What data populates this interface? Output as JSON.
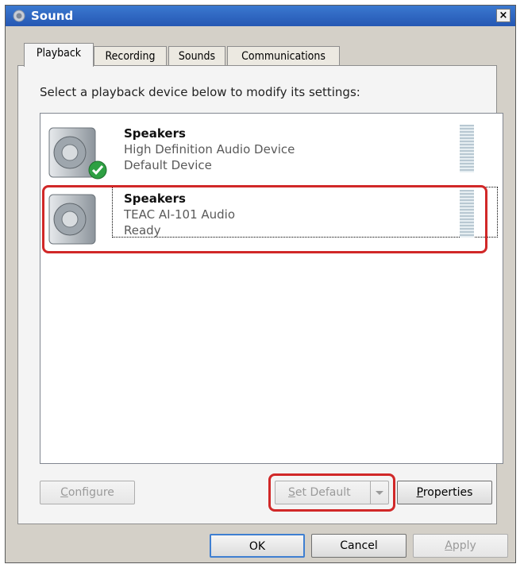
{
  "window": {
    "title": "Sound",
    "close_glyph": "×"
  },
  "tabs": [
    {
      "label": "Playback",
      "active": true
    },
    {
      "label": "Recording",
      "active": false
    },
    {
      "label": "Sounds",
      "active": false
    },
    {
      "label": "Communications",
      "active": false
    }
  ],
  "playback": {
    "instruction": "Select a playback device below to modify its settings:",
    "devices": [
      {
        "name": "Speakers",
        "description": "High Definition Audio Device",
        "status": "Default Device",
        "icon": "speaker-icon",
        "badge": "default-check-icon"
      },
      {
        "name": "Speakers",
        "description": "TEAC AI-101 Audio",
        "status": "Ready",
        "icon": "speaker-icon",
        "selected": true
      }
    ],
    "buttons": {
      "configure": {
        "label": "Configure",
        "mnemonic": "C",
        "rest": "onfigure",
        "enabled": false
      },
      "set_default": {
        "label": "Set Default",
        "mnemonic": "S",
        "rest": "et Default",
        "enabled": false
      },
      "properties": {
        "label": "Properties",
        "mnemonic": "P",
        "rest": "roperties",
        "enabled": true
      }
    }
  },
  "dialog_buttons": {
    "ok": "OK",
    "cancel": "Cancel",
    "apply": {
      "label": "Apply",
      "mnemonic": "A",
      "rest": "pply",
      "enabled": false
    }
  },
  "colors": {
    "highlight_ring": "#d12828",
    "titlebar": "#2557b3",
    "check_badge": "#2ea043"
  }
}
